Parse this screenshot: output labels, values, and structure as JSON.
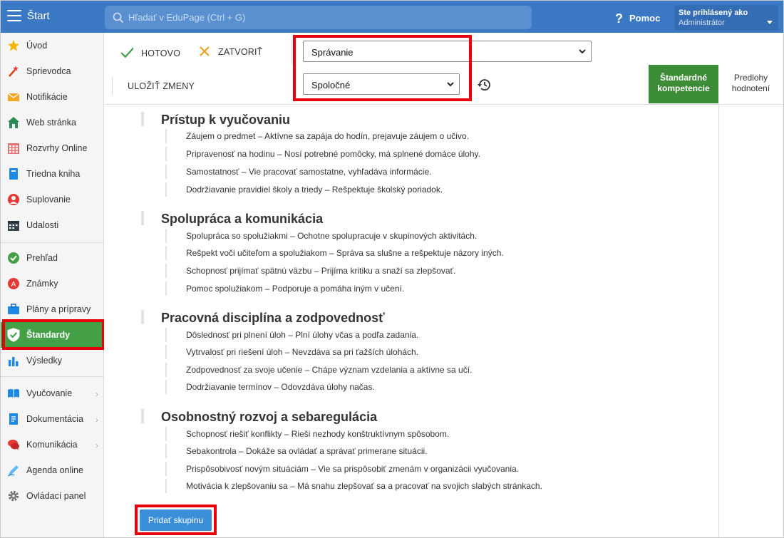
{
  "topbar": {
    "app_title": "Štart",
    "search_placeholder": "Hľadať v EduPage (Ctrl + G)",
    "help_label": "Pomoc",
    "user_line1": "Ste prihlásený ako",
    "user_line2": "Administrátor"
  },
  "sidebar": {
    "items": [
      {
        "label": "Úvod",
        "icon": "star-icon"
      },
      {
        "label": "Sprievodca",
        "icon": "magic-wand-icon"
      },
      {
        "label": "Notifikácie",
        "icon": "envelope-icon"
      },
      {
        "label": "Web stránka",
        "icon": "house-icon"
      },
      {
        "label": "Rozvrhy Online",
        "icon": "calendar-grid-icon"
      },
      {
        "label": "Triedna kniha",
        "icon": "book-icon"
      },
      {
        "label": "Suplovanie",
        "icon": "person-icon"
      },
      {
        "label": "Udalosti",
        "icon": "calendar-icon"
      },
      {
        "label": "Prehľad",
        "icon": "check-circle-icon"
      },
      {
        "label": "Známky",
        "icon": "grade-icon"
      },
      {
        "label": "Plány a prípravy",
        "icon": "briefcase-icon"
      },
      {
        "label": "Štandardy",
        "icon": "shield-check-icon"
      },
      {
        "label": "Výsledky",
        "icon": "bar-chart-icon"
      },
      {
        "label": "Vyučovanie",
        "icon": "open-book-icon"
      },
      {
        "label": "Dokumentácia",
        "icon": "document-icon"
      },
      {
        "label": "Komunikácia",
        "icon": "chat-icon"
      },
      {
        "label": "Agenda online",
        "icon": "pen-icon"
      },
      {
        "label": "Ovládací panel",
        "icon": "gear-icon"
      }
    ]
  },
  "toolbar": {
    "done_label": "HOTOVO",
    "close_label": "ZATVORIŤ",
    "save_label": "ULOŽIŤ ZMENY",
    "select1_value": "Správanie",
    "select2_value": "Spoločné",
    "tab_standard": "Štandardné kompetencie",
    "tab_templates": "Predlohy hodnotení"
  },
  "groups": [
    {
      "title": "Prístup k vyučovaniu",
      "items": [
        "Záujem o predmet – Aktívne sa zapája do hodín, prejavuje záujem o učivo.",
        "Pripravenosť na hodinu – Nosí potrebné pomôcky, má splnené domáce úlohy.",
        "Samostatnosť – Vie pracovať samostatne, vyhľadáva informácie.",
        "Dodržiavanie pravidiel školy a triedy – Rešpektuje školský poriadok."
      ]
    },
    {
      "title": "Spolupráca a komunikácia",
      "items": [
        "Spolupráca so spolužiakmi – Ochotne spolupracuje v skupinových aktivitách.",
        "Rešpekt voči učiteľom a spolužiakom – Správa sa slušne a rešpektuje názory iných.",
        "Schopnosť prijímať spätnú väzbu – Prijíma kritiku a snaží sa zlepšovať.",
        "Pomoc spolužiakom – Podporuje a pomáha iným v učení."
      ]
    },
    {
      "title": "Pracovná disciplína a zodpovednosť",
      "items": [
        "Dôslednosť pri plnení úloh – Plní úlohy včas a podľa zadania.",
        "Vytrvalosť pri riešení úloh – Nevzdáva sa pri ťažších úlohách.",
        "Zodpovednosť za svoje učenie – Chápe význam vzdelania a aktívne sa učí.",
        "Dodržiavanie termínov – Odovzdáva úlohy načas."
      ]
    },
    {
      "title": "Osobnostný rozvoj a sebaregulácia",
      "items": [
        "Schopnosť riešiť konflikty – Rieši nezhody konštruktívnym spôsobom.",
        "Sebakontrola – Dokáže sa ovládať a správať primerane situácii.",
        "Prispôsobivosť novým situáciám – Vie sa prispôsobiť zmenám v organizácii vyučovania.",
        "Motivácia k zlepšovaniu sa – Má snahu zlepšovať sa a pracovať na svojich slabých stránkach."
      ]
    }
  ],
  "add_group_label": "Pridať skupinu",
  "colors": {
    "topbar": "#3b79c4",
    "active_nav": "#43a047",
    "active_tab": "#3d8c37",
    "highlight": "#e8000b",
    "button": "#3b8fd9"
  }
}
